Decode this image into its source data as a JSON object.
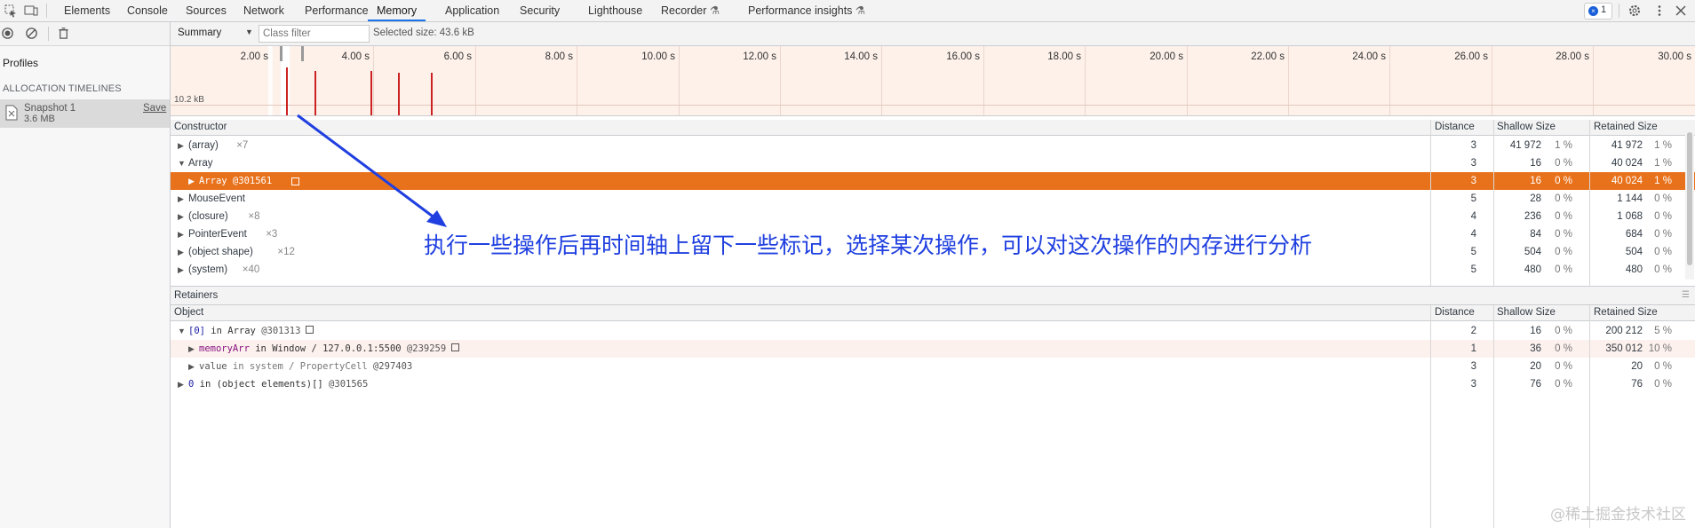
{
  "tabs": [
    {
      "label": "Elements"
    },
    {
      "label": "Console"
    },
    {
      "label": "Sources"
    },
    {
      "label": "Network"
    },
    {
      "label": "Performance"
    },
    {
      "label": "Memory"
    },
    {
      "label": "Application"
    },
    {
      "label": "Security"
    },
    {
      "label": "Lighthouse"
    },
    {
      "label": "Recorder"
    },
    {
      "label": "Performance insights"
    }
  ],
  "active_tab": "Memory",
  "issues_count": "1",
  "left": {
    "profiles_title": "Profiles",
    "section": "ALLOCATION TIMELINES",
    "snapshot_name": "Snapshot 1",
    "snapshot_size": "3.6 MB",
    "save_label": "Save"
  },
  "toolbar": {
    "view": "Summary",
    "class_filter_placeholder": "Class filter",
    "selected_size": "Selected size: 43.6 kB"
  },
  "timeline": {
    "ticks": [
      "2.00 s",
      "4.00 s",
      "6.00 s",
      "8.00 s",
      "10.00 s",
      "12.00 s",
      "14.00 s",
      "16.00 s",
      "18.00 s",
      "20.00 s",
      "22.00 s",
      "24.00 s",
      "26.00 s",
      "28.00 s",
      "30.00 s"
    ],
    "scale_label": "10.2 kB"
  },
  "constructors": {
    "headers": {
      "name": "Constructor",
      "distance": "Distance",
      "shallow": "Shallow Size",
      "retained": "Retained Size"
    },
    "rows": [
      {
        "name": "(array)",
        "count": "×7",
        "expanded": false,
        "distance": "3",
        "shallow": "41 972",
        "shallow_pct": "1 %",
        "retained": "41 972",
        "retained_pct": "1 %"
      },
      {
        "name": "Array",
        "count": "",
        "expanded": true,
        "distance": "3",
        "shallow": "16",
        "shallow_pct": "0 %",
        "retained": "40 024",
        "retained_pct": "1 %"
      },
      {
        "name": "Array @301561",
        "count": "",
        "expanded": false,
        "distance": "3",
        "shallow": "16",
        "shallow_pct": "0 %",
        "retained": "40 024",
        "retained_pct": "1 %"
      },
      {
        "name": "MouseEvent",
        "count": "",
        "expanded": false,
        "distance": "5",
        "shallow": "28",
        "shallow_pct": "0 %",
        "retained": "1 144",
        "retained_pct": "0 %"
      },
      {
        "name": "(closure)",
        "count": "×8",
        "expanded": false,
        "distance": "4",
        "shallow": "236",
        "shallow_pct": "0 %",
        "retained": "1 068",
        "retained_pct": "0 %"
      },
      {
        "name": "PointerEvent",
        "count": "×3",
        "expanded": false,
        "distance": "4",
        "shallow": "84",
        "shallow_pct": "0 %",
        "retained": "684",
        "retained_pct": "0 %"
      },
      {
        "name": "(object shape)",
        "count": "×12",
        "expanded": false,
        "distance": "5",
        "shallow": "504",
        "shallow_pct": "0 %",
        "retained": "504",
        "retained_pct": "0 %"
      },
      {
        "name": "(system)",
        "count": "×40",
        "expanded": false,
        "distance": "5",
        "shallow": "480",
        "shallow_pct": "0 %",
        "retained": "480",
        "retained_pct": "0 %"
      }
    ]
  },
  "retainers": {
    "title": "Retainers",
    "headers": {
      "name": "Object",
      "distance": "Distance",
      "shallow": "Shallow Size",
      "retained": "Retained Size"
    },
    "rows": [
      {
        "key": "[0]",
        "mid": " in Array ",
        "id": "@301313",
        "distance": "2",
        "shallow": "16",
        "shallow_pct": "0 %",
        "retained": "200 212",
        "retained_pct": "5 %"
      },
      {
        "key": "memoryArr",
        "mid": " in Window / 127.0.0.1:5500 ",
        "id": "@239259",
        "distance": "1",
        "shallow": "36",
        "shallow_pct": "0 %",
        "retained": "350 012",
        "retained_pct": "10 %"
      },
      {
        "key": "value",
        "mid": " in system / PropertyCell ",
        "id": "@297403",
        "distance": "3",
        "shallow": "20",
        "shallow_pct": "0 %",
        "retained": "20",
        "retained_pct": "0 %"
      },
      {
        "key": "0",
        "mid": " in (object elements)[] ",
        "id": "@301565",
        "distance": "3",
        "shallow": "76",
        "shallow_pct": "0 %",
        "retained": "76",
        "retained_pct": "0 %"
      }
    ]
  },
  "annotation": "执行一些操作后再时间轴上留下一些标记，选择某次操作，可以对这次操作的内存进行分析",
  "watermark": "@稀土掘金技术社区"
}
